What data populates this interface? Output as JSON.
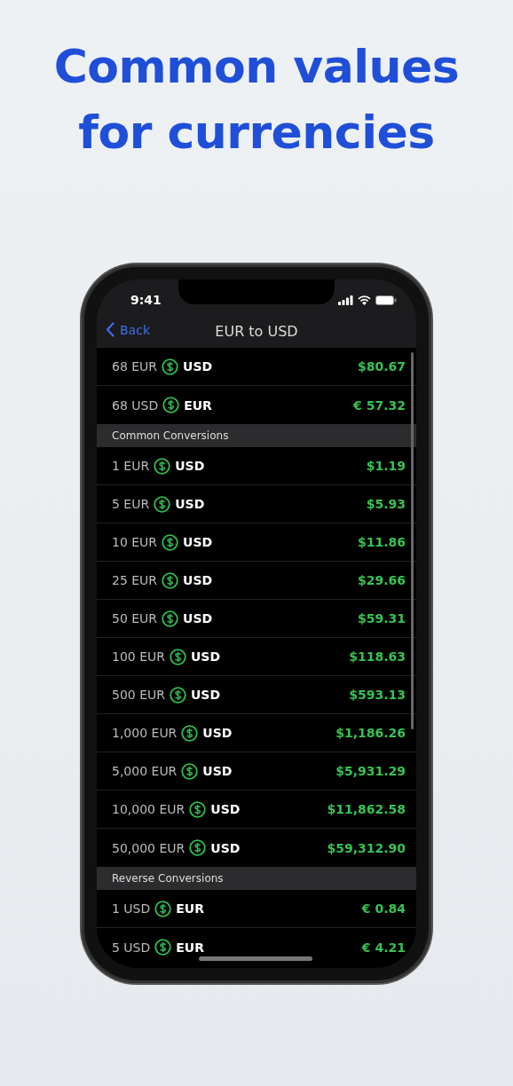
{
  "headline": [
    "Common values",
    "for currencies"
  ],
  "status_bar": {
    "time": "9:41"
  },
  "nav": {
    "back": "Back",
    "title": "EUR to USD"
  },
  "sections": [
    {
      "rows": [
        {
          "amount": "68 EUR",
          "target": "USD",
          "value": "$80.67"
        },
        {
          "amount": "68 USD",
          "target": "EUR",
          "value": "€ 57.32"
        }
      ]
    },
    {
      "header": "Common Conversions",
      "rows": [
        {
          "amount": "1 EUR",
          "target": "USD",
          "value": "$1.19"
        },
        {
          "amount": "5 EUR",
          "target": "USD",
          "value": "$5.93"
        },
        {
          "amount": "10 EUR",
          "target": "USD",
          "value": "$11.86"
        },
        {
          "amount": "25 EUR",
          "target": "USD",
          "value": "$29.66"
        },
        {
          "amount": "50 EUR",
          "target": "USD",
          "value": "$59.31"
        },
        {
          "amount": "100 EUR",
          "target": "USD",
          "value": "$118.63"
        },
        {
          "amount": "500 EUR",
          "target": "USD",
          "value": "$593.13"
        },
        {
          "amount": "1,000 EUR",
          "target": "USD",
          "value": "$1,186.26"
        },
        {
          "amount": "5,000 EUR",
          "target": "USD",
          "value": "$5,931.29"
        },
        {
          "amount": "10,000 EUR",
          "target": "USD",
          "value": "$11,862.58"
        },
        {
          "amount": "50,000 EUR",
          "target": "USD",
          "value": "$59,312.90"
        }
      ]
    },
    {
      "header": "Reverse Conversions",
      "rows": [
        {
          "amount": "1 USD",
          "target": "EUR",
          "value": "€ 0.84"
        },
        {
          "amount": "5 USD",
          "target": "EUR",
          "value": "€ 4.21"
        }
      ]
    }
  ]
}
